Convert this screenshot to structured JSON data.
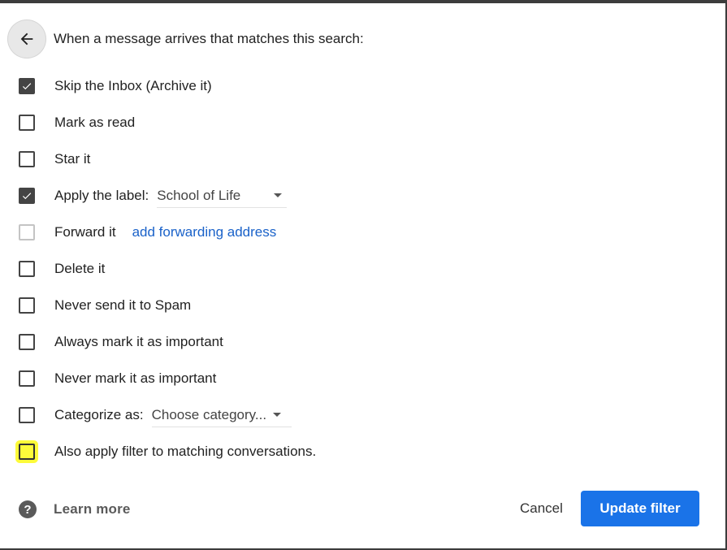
{
  "header": {
    "back_icon": "arrow-left-icon",
    "title": "When a message arrives that matches this search:"
  },
  "options": {
    "skip_inbox": {
      "label": "Skip the Inbox (Archive it)",
      "checked": true
    },
    "mark_read": {
      "label": "Mark as read",
      "checked": false
    },
    "star": {
      "label": "Star it",
      "checked": false
    },
    "apply_label": {
      "label": "Apply the label:",
      "checked": true,
      "value": "School of Life"
    },
    "forward": {
      "label": "Forward it",
      "checked": false,
      "disabled": true,
      "link": "add forwarding address"
    },
    "delete": {
      "label": "Delete it",
      "checked": false
    },
    "never_spam": {
      "label": "Never send it to Spam",
      "checked": false
    },
    "always_important": {
      "label": "Always mark it as important",
      "checked": false
    },
    "never_important": {
      "label": "Never mark it as important",
      "checked": false
    },
    "categorize": {
      "label": "Categorize as:",
      "checked": false,
      "value": "Choose category..."
    },
    "also_apply": {
      "label": "Also apply filter to matching conversations.",
      "checked": false,
      "highlight_color": "#fdfb3a"
    }
  },
  "footer": {
    "help_icon": "question-circle-icon",
    "learn_more": "Learn more",
    "cancel": "Cancel",
    "update": "Update filter"
  },
  "colors": {
    "primary": "#1a73e8",
    "link": "#1a62c9",
    "checkbox": "#444444"
  }
}
